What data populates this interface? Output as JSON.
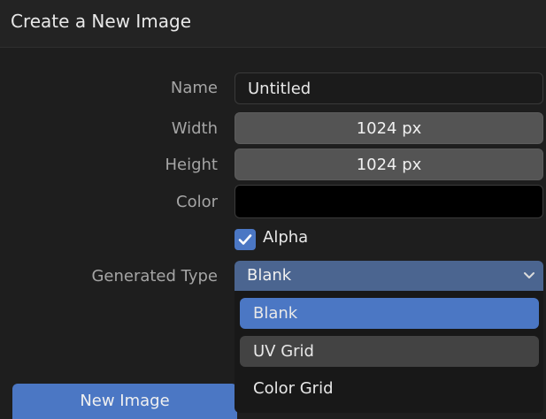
{
  "dialog": {
    "title": "Create a New Image",
    "fields": {
      "name": {
        "label": "Name",
        "value": "Untitled"
      },
      "width": {
        "label": "Width",
        "value": "1024 px"
      },
      "height": {
        "label": "Height",
        "value": "1024 px"
      },
      "color": {
        "label": "Color",
        "value_hex": "#000000"
      },
      "alpha": {
        "label": "Alpha",
        "checked": true
      },
      "generated_type": {
        "label": "Generated Type",
        "value": "Blank",
        "options": [
          "Blank",
          "UV Grid",
          "Color Grid"
        ]
      }
    },
    "actions": {
      "new_image_label": "New Image"
    }
  },
  "colors": {
    "accent": "#4b77c4",
    "select_bg": "#4b6590",
    "background": "#1e1e1e"
  },
  "icons": [
    "check-icon",
    "chevron-down-icon"
  ]
}
